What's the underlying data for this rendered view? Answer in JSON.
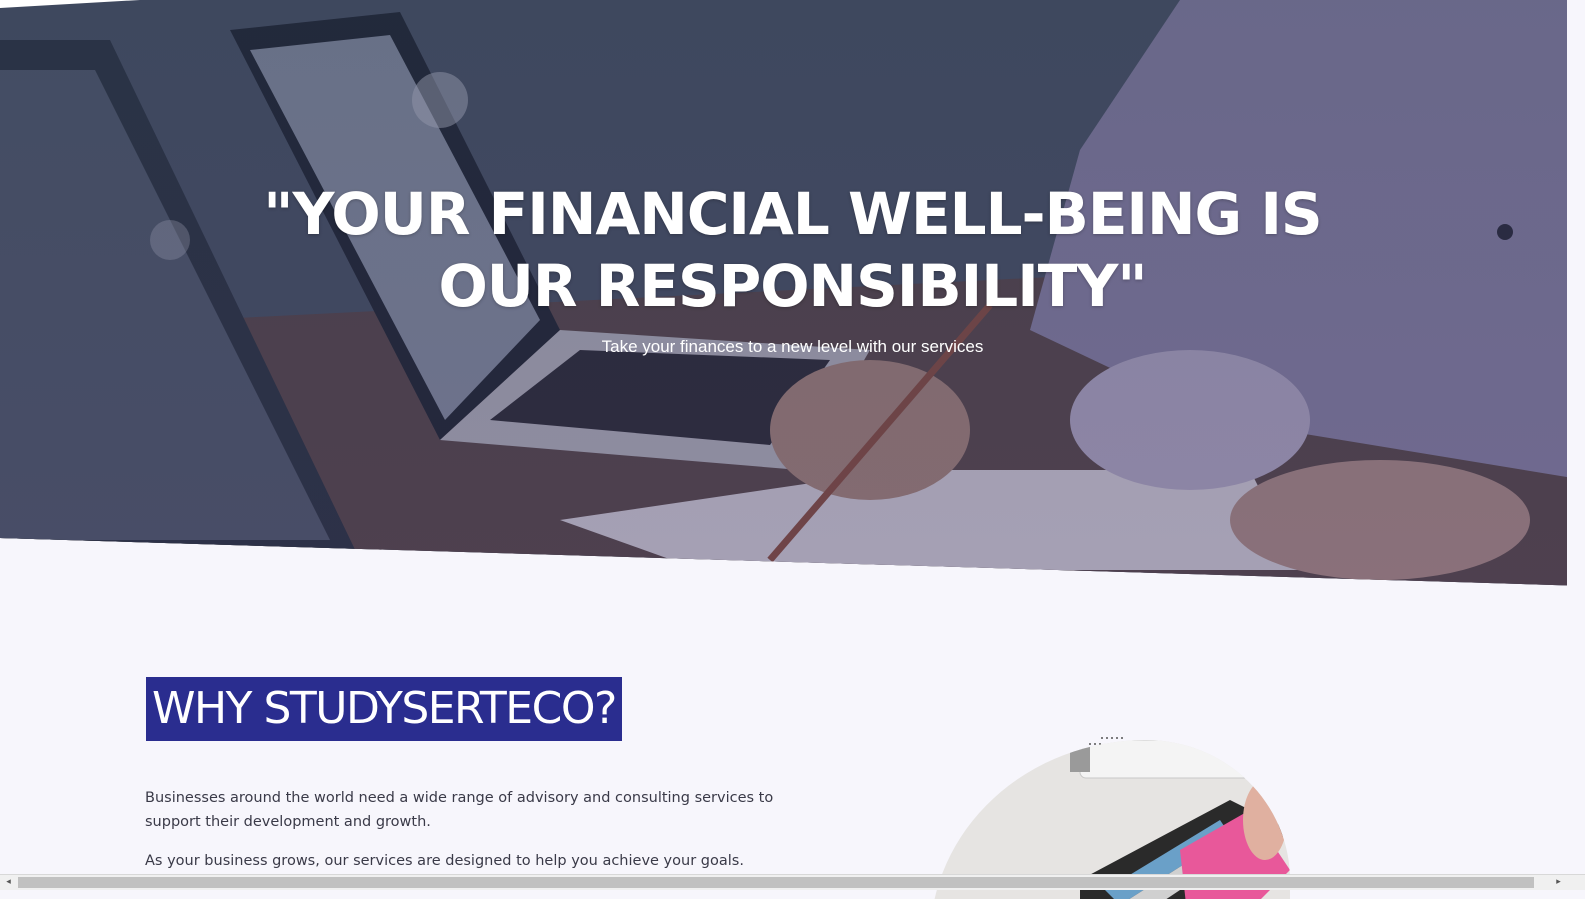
{
  "hero": {
    "title": "\"YOUR FINANCIAL WELL-BEING IS OUR RESPONSIBILITY\"",
    "subtitle": "Take your finances to a new level with our services"
  },
  "why": {
    "heading": "WHY STUDYSERTECO?",
    "paragraphs": [
      "Businesses around the world need a wide range of advisory and consulting services to support their development and growth.",
      "As your business grows, our services are designed to help you achieve your goals. Successful"
    ]
  },
  "colors": {
    "accent": "#2a2d8f",
    "background": "#f7f6fc",
    "text": "#3a3a48"
  },
  "scrollbar": {
    "left_arrow": "◂",
    "right_arrow": "▸"
  }
}
